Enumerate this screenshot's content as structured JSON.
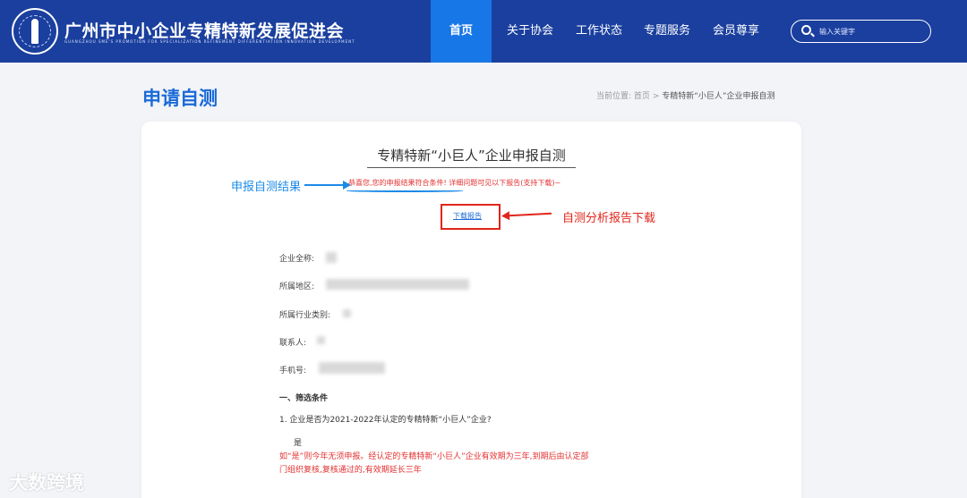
{
  "header": {
    "site_title": "广州市中小企业专精特新发展促进会",
    "site_subtitle": "GUANGZHOU SME'S PROMOTION FOR SPECIALIZATION REFINEMENT DIFFERENTIATION INNOVATION DEVELOPMENT",
    "nav": [
      {
        "label": "首页",
        "active": true
      },
      {
        "label": "关于协会",
        "active": false
      },
      {
        "label": "工作状态",
        "active": false
      },
      {
        "label": "专题服务",
        "active": false
      },
      {
        "label": "会员尊享",
        "active": false
      }
    ],
    "search_placeholder": "输入关键字",
    "bg_color": "#1a3f9e",
    "active_color": "#1877e6"
  },
  "page": {
    "title": "申请自测",
    "breadcrumb": {
      "prefix": "当前位置:",
      "home": "首页",
      "sep": ">",
      "current": "专精特新“小巨人”企业申报自测"
    }
  },
  "report": {
    "title": "专精特新“小巨人”企业申报自测",
    "result_message": "恭喜您,您的申报结果符合条件!  详细问题可见以下报告(支持下载)~",
    "download_label": "下载报告",
    "annotation_left": "申报自测结果",
    "annotation_right": "自测分析报告下载",
    "fields": [
      {
        "label": "企业全称:"
      },
      {
        "label": "所属地区:"
      },
      {
        "label": "所属行业类别:"
      },
      {
        "label": "联系人:"
      },
      {
        "label": "手机号:"
      }
    ],
    "section_heading": "一、筛选条件",
    "question": "1.   企业是否为2021-2022年认定的专精特新“小巨人”企业?",
    "answer": "是",
    "note_lines": [
      "如“是”则今年无须申报。经认定的专精特新“小巨人”企业有效期为三年,到期后由认定部",
      "门组织复核,复核通过的,有效期延长三年"
    ]
  },
  "watermark": "大数跨境"
}
